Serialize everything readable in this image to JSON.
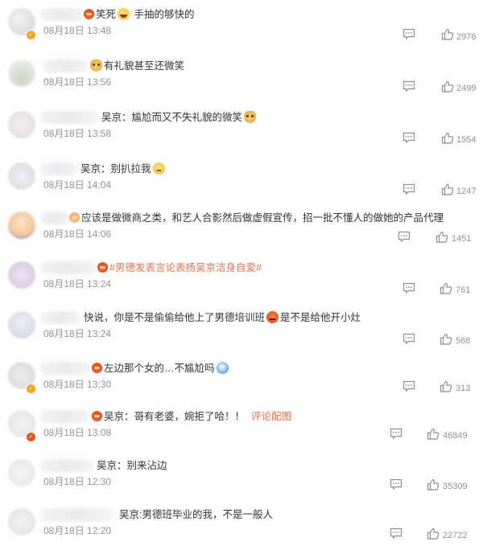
{
  "comments": [
    {
      "text": "笑死",
      "emoji": "laugh-emoji",
      "text2": " 手抽的够快的",
      "time": "08月18日 13:48",
      "likes": "2976"
    },
    {
      "text": "",
      "emoji": "doge-emoji",
      "text2": "有礼貌甚至还微笑",
      "time": "08月18日 13:56",
      "likes": "2499"
    },
    {
      "text": "吴京：尴尬而又不失礼貌的微笑",
      "emoji": "doge-emoji",
      "time": "08月18日 13:58",
      "likes": "1554"
    },
    {
      "text": "吴京：别扒拉我",
      "emoji": "thinking-emoji",
      "time": "08月18日 14:04",
      "likes": "1247"
    },
    {
      "text": "应该是做微商之类，和艺人合影然后做虚假宣传，招一批不懂人的做她的产品代理",
      "time": "08月18日 14:06",
      "likes": "1451"
    },
    {
      "hashtag": "#男德发表言论表扬吴京洁身自爱#",
      "time": "08月18日 13:24",
      "likes": "761"
    },
    {
      "text": "快说，你是不是偷偷给他上了男德培训班",
      "emoji": "angry-emoji",
      "text2": "是不是给他开小灶",
      "time": "08月18日 13:24",
      "likes": "568"
    },
    {
      "text": "左边那个女的…不尴尬吗",
      "emoji": "doraemon-emoji",
      "time": "08月18日 13:30",
      "likes": "313"
    },
    {
      "text": "吴京：哥有老婆，婉拒了哈！！",
      "link": "评论配图",
      "time": "08月18日 13:08",
      "likes": "46849"
    },
    {
      "text": "吴京：别来沾边",
      "time": "08月18日 12:30",
      "likes": "35309"
    },
    {
      "text": "吴京:男德班毕业的我，不是一般人",
      "time": "08月18日 12:20",
      "likes": "22722"
    }
  ],
  "colors": {
    "accent": "#eb7350",
    "meta": "#939393",
    "text": "#333333"
  }
}
